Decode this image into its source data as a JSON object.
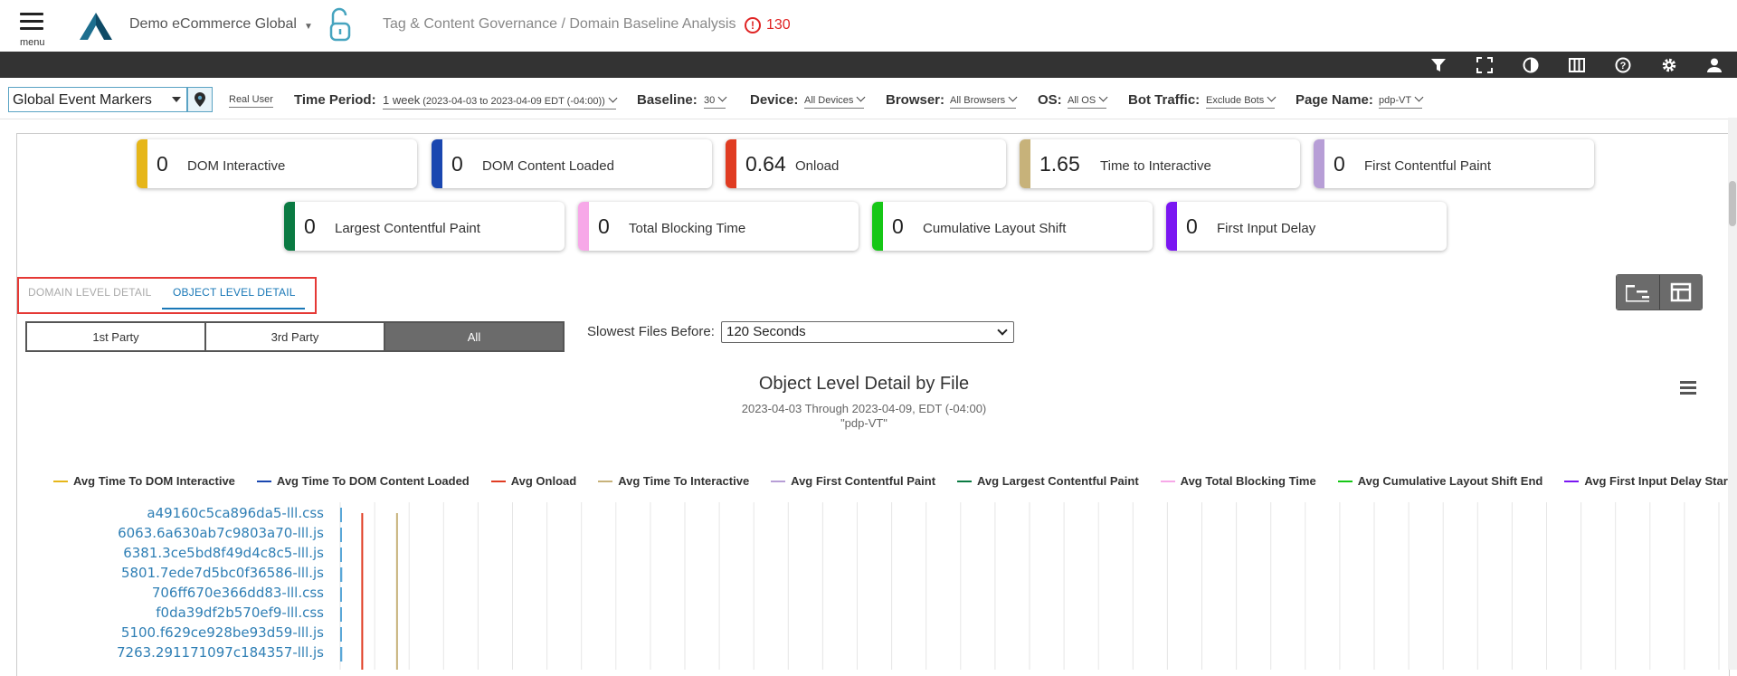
{
  "header": {
    "menu_label": "menu",
    "company": "Demo eCommerce Global",
    "breadcrumb": "Tag & Content Governance / Domain Baseline Analysis",
    "alert_count": "130",
    "colors": {
      "accent": "#1a78b7",
      "alert": "#e02424",
      "toolbar": "#333333"
    }
  },
  "toolbar_icons": [
    "filter-icon",
    "fullscreen-icon",
    "contrast-icon",
    "columns-icon",
    "help-icon",
    "gear-icon",
    "user-icon"
  ],
  "filters": {
    "event_markers": "Global Event Markers",
    "real_user": "Real User",
    "time_period_label": "Time Period:",
    "time_period_main": "1 week",
    "time_period_range": "(2023-04-03 to 2023-04-09 EDT (-04:00))",
    "baseline_label": "Baseline:",
    "baseline_value": "30",
    "device_label": "Device:",
    "device_value": "All Devices",
    "browser_label": "Browser:",
    "browser_value": "All Browsers",
    "os_label": "OS:",
    "os_value": "All OS",
    "bot_label": "Bot Traffic:",
    "bot_value": "Exclude Bots",
    "page_label": "Page Name:",
    "page_value": "pdp-VT"
  },
  "kpis": [
    {
      "value": "0",
      "name": "DOM Interactive",
      "color": "#e6b619"
    },
    {
      "value": "0",
      "name": "DOM Content Loaded",
      "color": "#1a47b0"
    },
    {
      "value": "0.64",
      "name": "Onload",
      "color": "#e03c22"
    },
    {
      "value": "1.65",
      "name": "Time to Interactive",
      "color": "#c7b27a"
    },
    {
      "value": "0",
      "name": "First Contentful Paint",
      "color": "#b79ed6"
    },
    {
      "value": "0",
      "name": "Largest Contentful Paint",
      "color": "#0a7a42"
    },
    {
      "value": "0",
      "name": "Total Blocking Time",
      "color": "#f7a8e8"
    },
    {
      "value": "0",
      "name": "Cumulative Layout Shift",
      "color": "#16c716"
    },
    {
      "value": "0",
      "name": "First Input Delay",
      "color": "#7a16f2"
    }
  ],
  "tabs": {
    "domain": "DOMAIN LEVEL DETAIL",
    "object": "OBJECT LEVEL DETAIL",
    "active": "object"
  },
  "party": {
    "first": "1st Party",
    "third": "3rd Party",
    "all": "All",
    "selected": "All"
  },
  "slowest": {
    "label": "Slowest Files Before:",
    "value": "120 Seconds"
  },
  "chart_data": {
    "type": "bar",
    "title": "Object Level Detail by File",
    "subtitle_line1": "2023-04-03 Through 2023-04-09, EDT (-04:00)",
    "subtitle_line2": "\"pdp-VT\"",
    "categories": [
      "a49160c5ca896da5-lll.css",
      "6063.6a630ab7c9803a70-lll.js",
      "6381.3ce5bd8f49d4c8c5-lll.js",
      "5801.7ede7d5bc0f36586-lll.js",
      "706ff670e366dd83-lll.css",
      "f0da39df2b570ef9-lll.css",
      "5100.f629ce928be93d59-lll.js",
      "7263.291171097c184357-lll.js"
    ],
    "series": [
      {
        "name": "Avg Time To DOM Interactive",
        "color": "#e6b619",
        "value": 0
      },
      {
        "name": "Avg Time To DOM Content Loaded",
        "color": "#1a47b0",
        "value": 0
      },
      {
        "name": "Avg Onload",
        "color": "#e03c22",
        "value": 0.64
      },
      {
        "name": "Avg Time To Interactive",
        "color": "#c7b27a",
        "value": 1.65
      },
      {
        "name": "Avg First Contentful Paint",
        "color": "#b79ed6",
        "value": 0
      },
      {
        "name": "Avg Largest Contentful Paint",
        "color": "#0a7a42",
        "value": 0
      },
      {
        "name": "Avg Total Blocking Time",
        "color": "#f7a8e8",
        "value": 0
      },
      {
        "name": "Avg Cumulative Layout Shift End",
        "color": "#16c716",
        "value": 0
      },
      {
        "name": "Avg First Input Delay Start",
        "color": "#7a16f2",
        "value": 0
      }
    ],
    "file_bar_values": [
      0.05,
      0.04,
      0.04,
      0.06,
      0.05,
      0.04,
      0.05,
      0.06
    ],
    "xlim": [
      0,
      40
    ],
    "grid": true,
    "legend": "top"
  }
}
